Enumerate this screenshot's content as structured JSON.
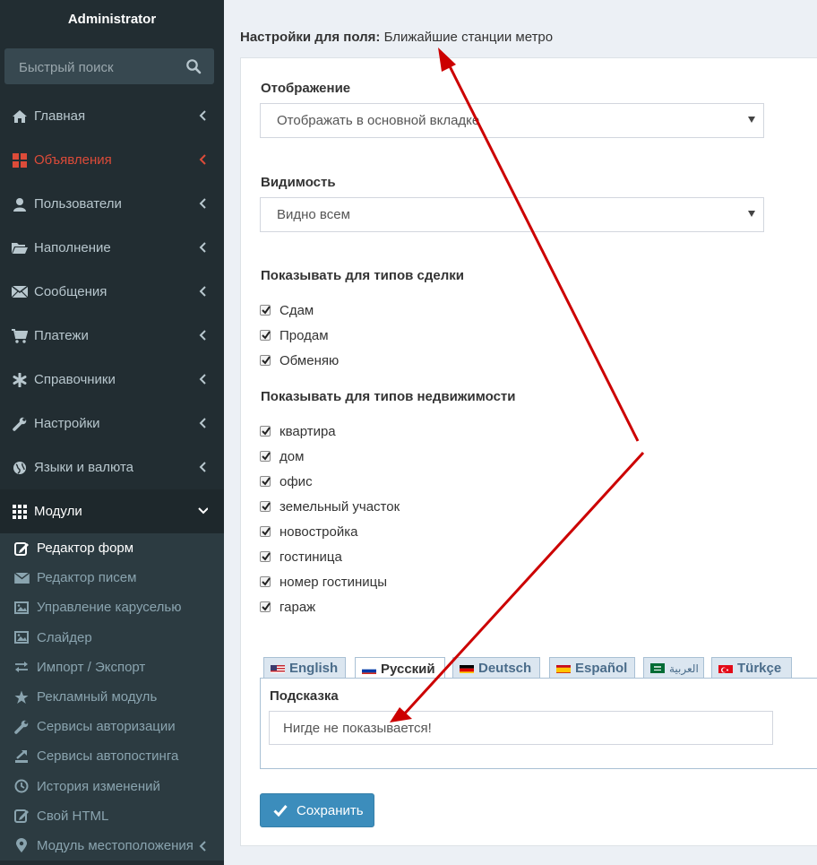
{
  "sidebar": {
    "user_title": "Administrator",
    "search_placeholder": "Быстрый поиск",
    "items": [
      {
        "label": "Главная",
        "icon": "home-icon"
      },
      {
        "label": "Объявления",
        "icon": "grid-icon"
      },
      {
        "label": "Пользователи",
        "icon": "user-icon"
      },
      {
        "label": "Наполнение",
        "icon": "folder-open-icon"
      },
      {
        "label": "Сообщения",
        "icon": "envelope-icon"
      },
      {
        "label": "Платежи",
        "icon": "cart-icon"
      },
      {
        "label": "Справочники",
        "icon": "asterisk-icon"
      },
      {
        "label": "Настройки",
        "icon": "wrench-icon"
      },
      {
        "label": "Языки и валюта",
        "icon": "globe-icon"
      },
      {
        "label": "Модули",
        "icon": "th-icon"
      }
    ],
    "sub_items": [
      {
        "label": "Редактор форм",
        "icon": "edit-icon"
      },
      {
        "label": "Редактор писем",
        "icon": "envelope-icon"
      },
      {
        "label": "Управление каруселью",
        "icon": "picture-icon"
      },
      {
        "label": "Слайдер",
        "icon": "picture-icon"
      },
      {
        "label": "Импорт / Экспорт",
        "icon": "transfer-icon"
      },
      {
        "label": "Рекламный модуль",
        "icon": "star-icon"
      },
      {
        "label": "Сервисы авторизации",
        "icon": "wrench-icon"
      },
      {
        "label": "Сервисы автопостинга",
        "icon": "export-icon"
      },
      {
        "label": "История изменений",
        "icon": "clock-icon"
      },
      {
        "label": "Свой HTML",
        "icon": "edit-icon"
      },
      {
        "label": "Модуль местоположения",
        "icon": "map-marker-icon"
      }
    ]
  },
  "main": {
    "heading_label": "Настройки для поля:",
    "heading_value": "Ближайшие станции метро",
    "display": {
      "label": "Отображение",
      "value": "Отображать в основной вкладке"
    },
    "visibility": {
      "label": "Видимость",
      "value": "Видно всем"
    },
    "deal_types": {
      "label": "Показывать для типов сделки",
      "options": [
        "Сдам",
        "Продам",
        "Обменяю"
      ]
    },
    "property_types": {
      "label": "Показывать для типов недвижимости",
      "options": [
        "квартира",
        "дом",
        "офис",
        "земельный участок",
        "новостройка",
        "гостиница",
        "номер гостиницы",
        "гараж"
      ]
    },
    "lang_tabs": [
      "English",
      "Русский",
      "Deutsch",
      "Español",
      "العربية",
      "Türkçe"
    ],
    "active_tab": "Русский",
    "hint": {
      "label": "Подсказка",
      "value": "Нигде не показывается!"
    },
    "save_label": "Сохранить"
  },
  "colors": {
    "sidebar_bg": "#222d32",
    "accent_red": "#dd4b39",
    "button_blue": "#3c8dbc",
    "annotation_arrow": "#cc0000"
  }
}
